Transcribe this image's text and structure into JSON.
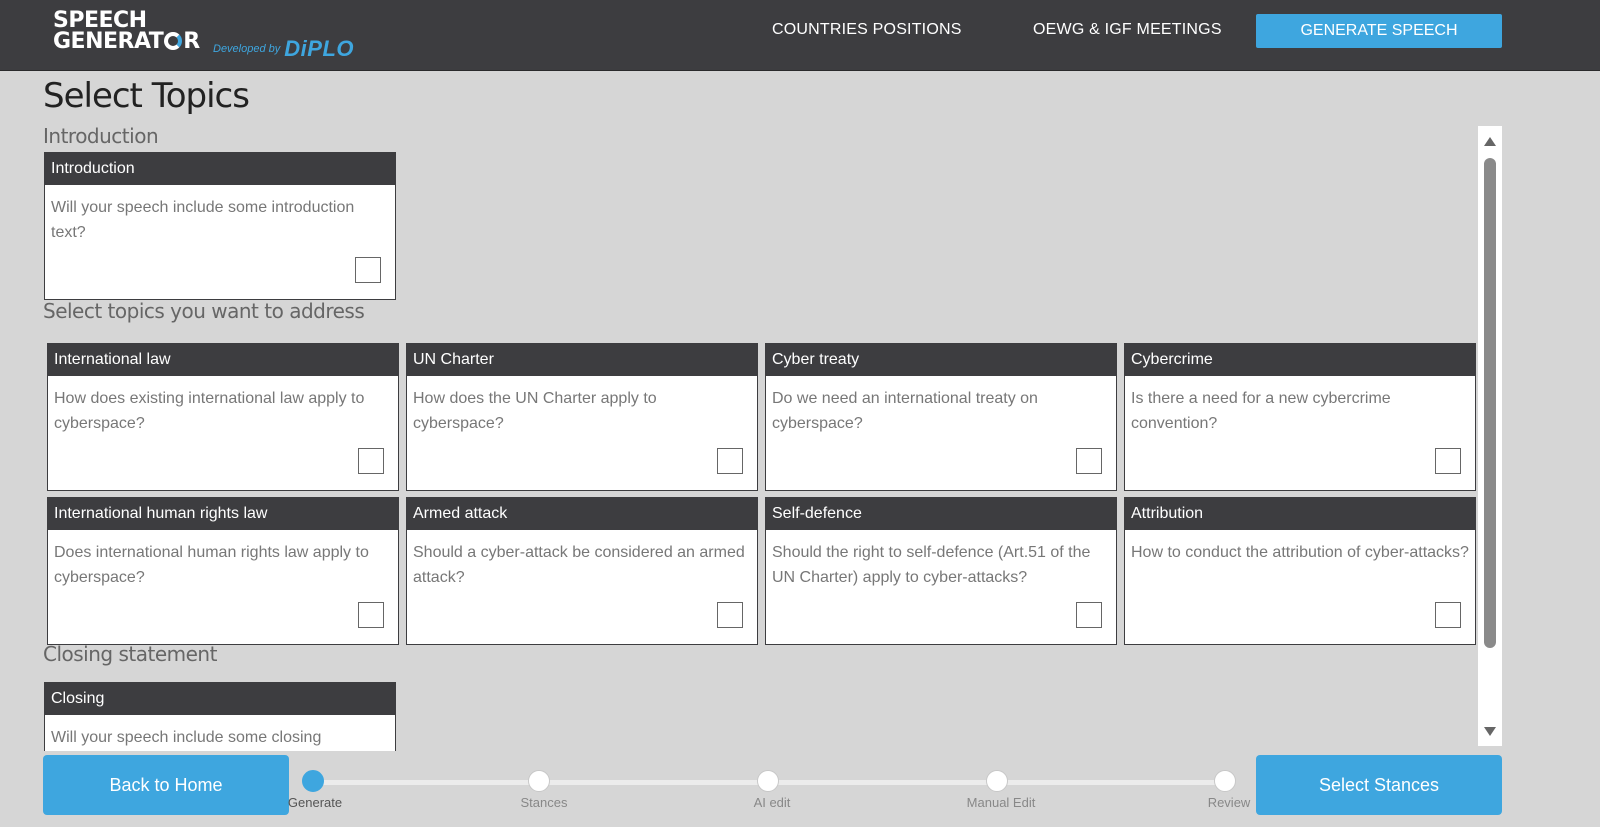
{
  "header": {
    "logo_line1": "SPEECH",
    "logo_line2_a": "GENERAT",
    "logo_line2_b": "R",
    "developed_by": "Developed by",
    "brand": "DiPLO",
    "nav": [
      "COUNTRIES POSITIONS",
      "OEWG & IGF MEETINGS"
    ],
    "cta": "GENERATE SPEECH"
  },
  "page_title": "Select Topics",
  "sections": {
    "introduction": "Introduction",
    "topics": "Select topics you want to address",
    "closing": "Closing statement"
  },
  "cards": {
    "intro": {
      "title": "Introduction",
      "question": "Will your speech include some introduction text?",
      "checked": false
    },
    "international_law": {
      "title": "International law",
      "question": "How does existing international law apply to cyberspace?",
      "checked": false
    },
    "un_charter": {
      "title": "UN Charter",
      "question": "How does the UN Charter apply to cyberspace?",
      "checked": false
    },
    "cyber_treaty": {
      "title": "Cyber treaty",
      "question": "Do we need an international treaty on cyberspace?",
      "checked": false
    },
    "cybercrime": {
      "title": "Cybercrime",
      "question": "Is there a need for a new cybercrime convention?",
      "checked": false
    },
    "human_rights": {
      "title": "International human rights law",
      "question": "Does international human rights law apply to cyberspace?",
      "checked": false
    },
    "armed_attack": {
      "title": "Armed attack",
      "question": "Should a cyber-attack be considered an armed attack?",
      "checked": false
    },
    "self_defence": {
      "title": "Self-defence",
      "question": "Should the right to self-defence (Art.51 of the UN Charter) apply to cyber-attacks?",
      "checked": false
    },
    "attribution": {
      "title": "Attribution",
      "question": "How to conduct the attribution of cyber-attacks?",
      "checked": false
    },
    "closing": {
      "title": "Closing",
      "question": "Will your speech include some closing statement?",
      "checked": false
    }
  },
  "footer": {
    "back": "Back to Home",
    "next": "Select Stances",
    "steps": [
      "Generate",
      "Stances",
      "AI edit",
      "Manual Edit",
      "Review"
    ],
    "current_step": 1
  },
  "colors": {
    "accent": "#3ea6df",
    "dark": "#3d3d40",
    "background": "#d6d6d6"
  }
}
